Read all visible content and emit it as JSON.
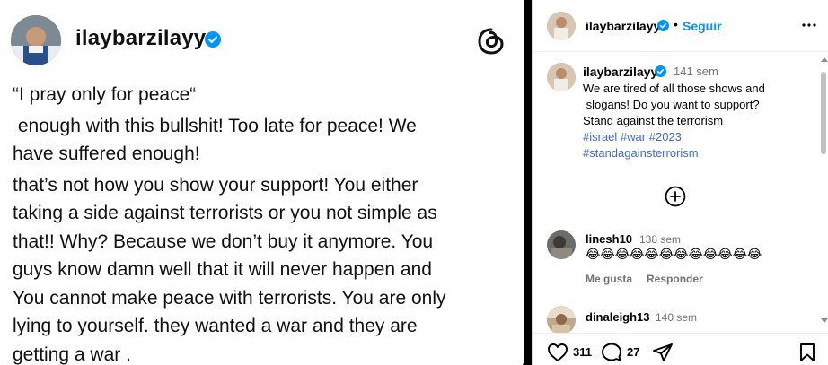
{
  "post_image": {
    "username": "ilaybarzilayy",
    "paragraphs": [
      "“I pray only for peace“",
      " enough with this bullshit! Too late for peace! We\nhave suffered enough!",
      "that’s not how you show your support! You either\ntaking a side against terrorists or you not simple as\nthat!! Why? Because we don’t buy it anymore. You\nguys know damn well that it will never happen and\nYou cannot make peace with terrorists. You are only\nlying to yourself. they wanted a war and they are\ngetting a war ."
    ],
    "icons": {
      "verified": "verified-badge-icon",
      "logo": "threads-logo-icon"
    }
  },
  "header": {
    "username": "ilaybarzilayy",
    "dot": "•",
    "follow_label": "Seguir",
    "icons": {
      "verified": "verified-badge-icon",
      "more": "more-options-icon"
    }
  },
  "caption": {
    "username": "ilaybarzilayy",
    "time": "141 sem",
    "lines": [
      "We are tired of all those shows and",
      " slogans! Do you want to support?",
      "Stand against the terrorism"
    ],
    "tags_line1": [
      "#israel",
      "#war",
      "#2023"
    ],
    "tags_line2": [
      "#standagainsterrorism"
    ]
  },
  "load_more": {
    "icon": "plus-circle-icon"
  },
  "comments": [
    {
      "username": "linesh10",
      "time": "138 sem",
      "text": "😂😂😂😂😂😂😂😂😂😂😂😂",
      "like_label": "Me gusta",
      "reply_label": "Responder"
    },
    {
      "username": "dinaleigh13",
      "time": "140 sem",
      "text": ""
    }
  ],
  "footer": {
    "like_count": "311",
    "comment_count": "27",
    "icons": {
      "like": "heart-icon",
      "comment": "comment-bubble-icon",
      "share": "share-icon",
      "save": "bookmark-icon"
    }
  },
  "colors": {
    "accent": "#0095f6",
    "hashtag": "#3f6ad8",
    "verified": "#0095f6",
    "muted": "#737373"
  }
}
